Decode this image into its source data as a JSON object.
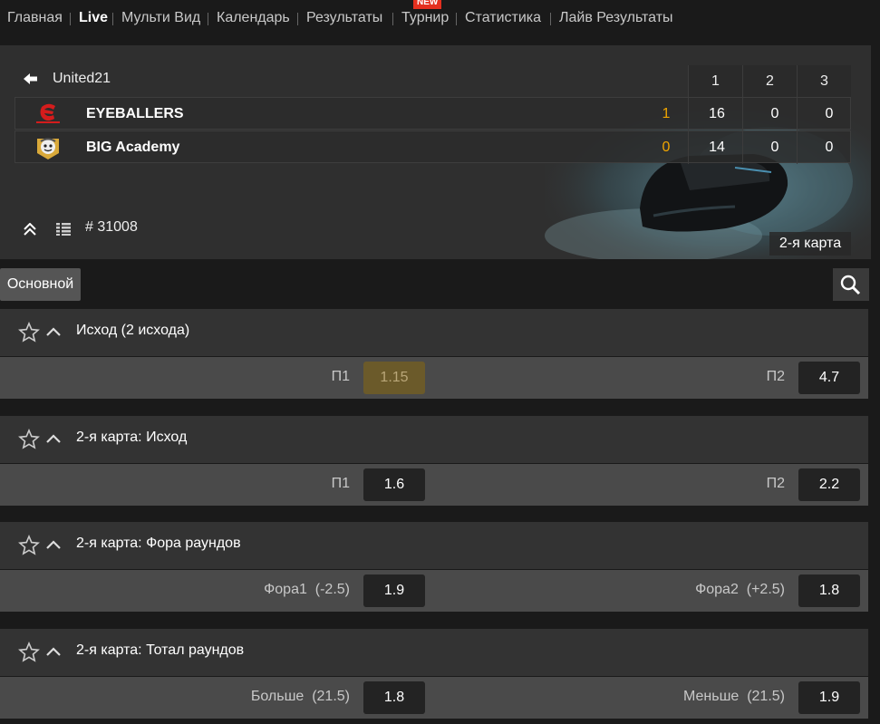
{
  "nav": {
    "items": [
      "Главная",
      "Live",
      "Мульти Вид",
      "Календарь",
      "Результаты",
      "Турнир",
      "Статистика",
      "Лайв Результаты"
    ],
    "badge": "NEW"
  },
  "scoreboard": {
    "tournament": "United21",
    "map_headers": [
      "1",
      "2",
      "3"
    ],
    "teams": [
      {
        "name": "EYEBALLERS",
        "total": "1",
        "maps": [
          "16",
          "0",
          "0"
        ]
      },
      {
        "name": "BIG Academy",
        "total": "0",
        "maps": [
          "14",
          "0",
          "0"
        ]
      }
    ],
    "current_map": "2-я карта",
    "game_id": "# 31008"
  },
  "filter": {
    "main_tab": "Основной"
  },
  "markets": [
    {
      "title": "Исход (2 исхода)",
      "left_label": "П1",
      "left_value": "",
      "left_odd": "1.15",
      "right_label": "П2",
      "right_value": "",
      "right_odd": "4.7"
    },
    {
      "title": "2-я карта: Исход",
      "left_label": "П1",
      "left_value": "",
      "left_odd": "1.6",
      "right_label": "П2",
      "right_value": "",
      "right_odd": "2.2"
    },
    {
      "title": "2-я карта: Фора раундов",
      "left_label": "Фора1",
      "left_value": "(-2.5)",
      "left_odd": "1.9",
      "right_label": "Фора2",
      "right_value": "(+2.5)",
      "right_odd": "1.8"
    },
    {
      "title": "2-я карта: Тотал раундов",
      "left_label": "Больше",
      "left_value": "(21.5)",
      "left_odd": "1.8",
      "right_label": "Меньше",
      "right_value": "(21.5)",
      "right_odd": "1.9"
    }
  ],
  "colors": {
    "accent": "#f0a500",
    "badge": "#e4301f",
    "locked": "#6b5a2a"
  }
}
